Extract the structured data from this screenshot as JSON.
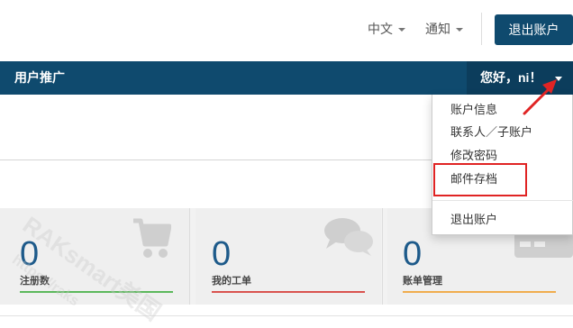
{
  "header": {
    "language_label": "中文",
    "notifications_label": "通知",
    "logout_label": "退出账户"
  },
  "nav": {
    "referral_label": "用户推广",
    "greeting_label": "您好，ni！"
  },
  "user_menu": {
    "items": [
      {
        "label": "账户信息"
      },
      {
        "label": "联系人／子账户"
      },
      {
        "label": "修改密码"
      },
      {
        "label": "邮件存档",
        "highlighted": true
      },
      {
        "label": "退出账户"
      }
    ]
  },
  "stats": [
    {
      "value": "0",
      "label": "注册数",
      "color": "#5cb85c",
      "icon": "cart-icon"
    },
    {
      "value": "0",
      "label": "我的工单",
      "color": "#d9534f",
      "icon": "chat-bubbles-icon"
    },
    {
      "value": "0",
      "label": "账单管理",
      "color": "#f0ad4e",
      "icon": "credit-card-icon"
    }
  ],
  "watermark": {
    "text": "RAKsmart美国",
    "sub_text": "https://raks"
  },
  "colors": {
    "nav_background": "#0f4a6e",
    "accent_blue": "#1d5a8a",
    "highlight_red": "#e02424"
  }
}
